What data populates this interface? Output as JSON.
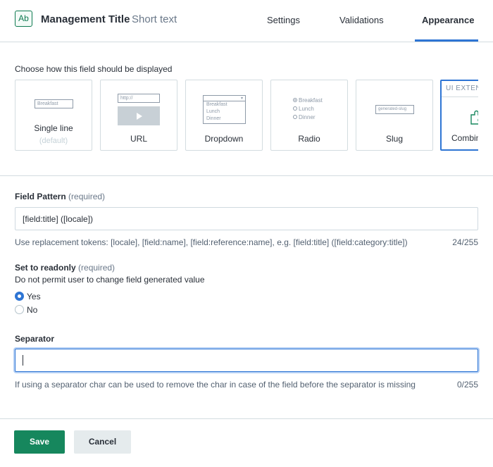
{
  "header": {
    "icon_text": "Ab",
    "title": "Management Title",
    "field_type": "Short text",
    "tabs": [
      {
        "label": "Settings"
      },
      {
        "label": "Validations"
      },
      {
        "label": "Appearance"
      }
    ],
    "active_tab": "Appearance"
  },
  "appearance": {
    "prompt": "Choose how this field should be displayed",
    "cards": [
      {
        "label": "Single line",
        "sub": "(default)",
        "preview_text": "Breakfast"
      },
      {
        "label": "URL",
        "preview_text": "http://"
      },
      {
        "label": "Dropdown",
        "options": [
          "Breakfast",
          "Lunch",
          "Dinner"
        ]
      },
      {
        "label": "Radio",
        "options": [
          "Breakfast",
          "Lunch",
          "Dinner"
        ]
      },
      {
        "label": "Slug",
        "preview_text": "generated-slug"
      },
      {
        "label": "Combin",
        "band": "UI EXTEN",
        "icon": "puzzle-icon"
      }
    ],
    "selected_card": "Combin"
  },
  "field_pattern": {
    "label": "Field Pattern",
    "required": "(required)",
    "value": "[field:title] ([locale])",
    "help": "Use replacement tokens: [locale], [field:name], [field:reference:name], e.g. [field:title] ([field:category:title])",
    "counter": "24/255"
  },
  "readonly": {
    "label": "Set to readonly",
    "required": "(required)",
    "description": "Do not permit user to change field generated value",
    "options": [
      {
        "label": "Yes",
        "checked": true
      },
      {
        "label": "No",
        "checked": false
      }
    ]
  },
  "separator": {
    "label": "Separator",
    "value": "",
    "help": "If using a separator char can be used to remove the char in case of the field before the separator is missing",
    "counter": "0/255"
  },
  "footer": {
    "save_label": "Save",
    "cancel_label": "Cancel"
  },
  "colors": {
    "accent": "#2e75d4",
    "primary_button": "#16875d",
    "secondary_button": "#e5ebed"
  }
}
